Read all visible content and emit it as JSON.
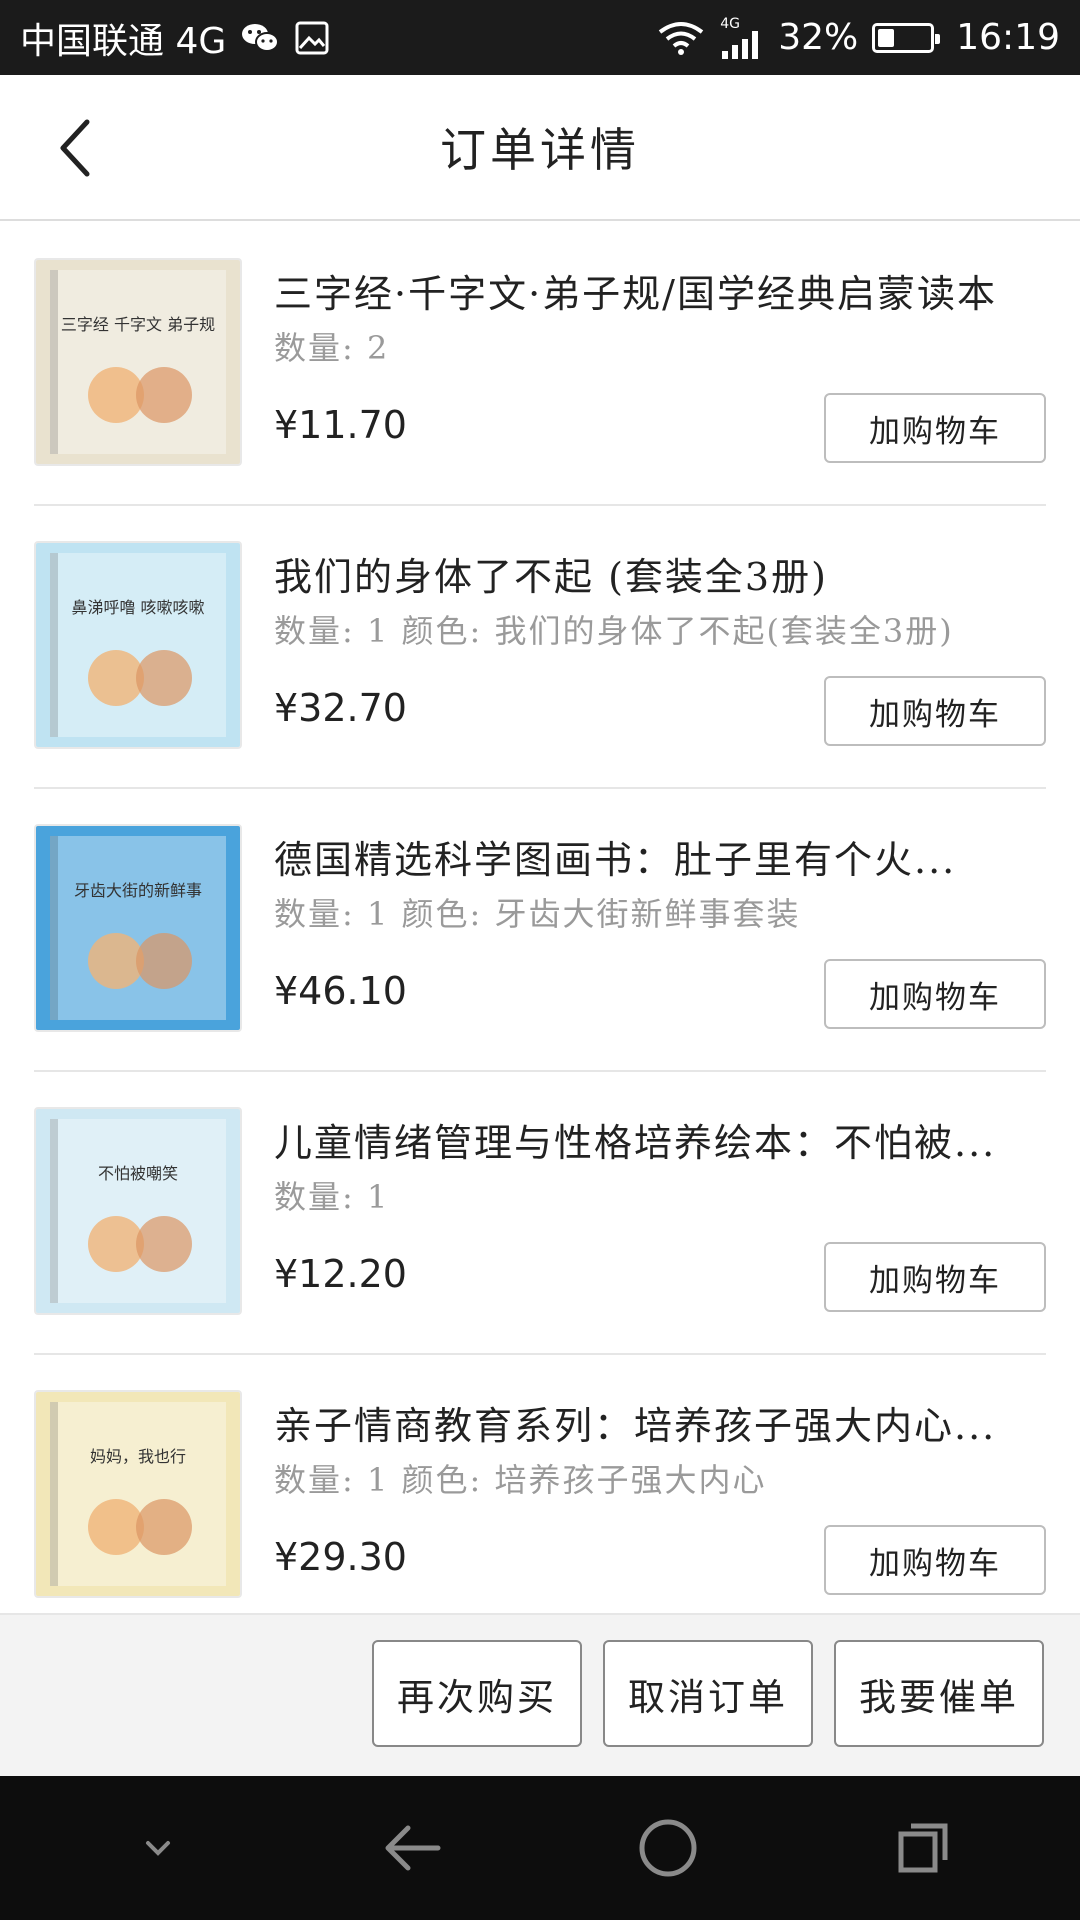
{
  "status_bar": {
    "carrier": "中国联通 4G",
    "signal_tag": "4G",
    "battery_percent": "32%",
    "battery_level": 0.32,
    "time": "16:19"
  },
  "header": {
    "title": "订单详情"
  },
  "items": [
    {
      "title": "三字经·千字文·弟子规/国学经典启蒙读本",
      "meta": "数量: 2",
      "price": "¥11.70",
      "button": "加购物车",
      "cover_text": "三字经 千字文 弟子规",
      "cover_color": "#e9e2cf"
    },
    {
      "title": "我们的身体了不起 (套装全3册)",
      "meta": "数量: 1 颜色: 我们的身体了不起(套装全3册)",
      "price": "¥32.70",
      "button": "加购物车",
      "cover_text": "鼻涕呼噜 咳嗽咳嗽",
      "cover_color": "#bfe3f2"
    },
    {
      "title": "德国精选科学图画书：肚子里有个火...",
      "meta": "数量: 1 颜色: 牙齿大街新鲜事套装",
      "price": "¥46.10",
      "button": "加购物车",
      "cover_text": "牙齿大街的新鲜事",
      "cover_color": "#4aa3dc"
    },
    {
      "title": "儿童情绪管理与性格培养绘本：不怕被...",
      "meta": "数量: 1",
      "price": "¥12.20",
      "button": "加购物车",
      "cover_text": "不怕被嘲笑",
      "cover_color": "#cfe8f3"
    },
    {
      "title": "亲子情商教育系列：培养孩子强大内心...",
      "meta": "数量: 1 颜色: 培养孩子强大内心",
      "price": "¥29.30",
      "button": "加购物车",
      "cover_text": "妈妈，我也行",
      "cover_color": "#f2e7b8"
    }
  ],
  "actions": {
    "buy_again": "再次购买",
    "cancel_order": "取消订单",
    "urge_order": "我要催单"
  },
  "icons": {
    "back": "chevron-left-icon",
    "wechat": "wechat-icon",
    "gallery": "image-icon",
    "wifi": "wifi-icon",
    "signal": "signal-icon",
    "battery": "battery-icon",
    "nav_down": "chevron-down-icon",
    "nav_back": "arrow-left-icon",
    "nav_home": "circle-home-icon",
    "nav_recent": "recent-apps-icon"
  }
}
